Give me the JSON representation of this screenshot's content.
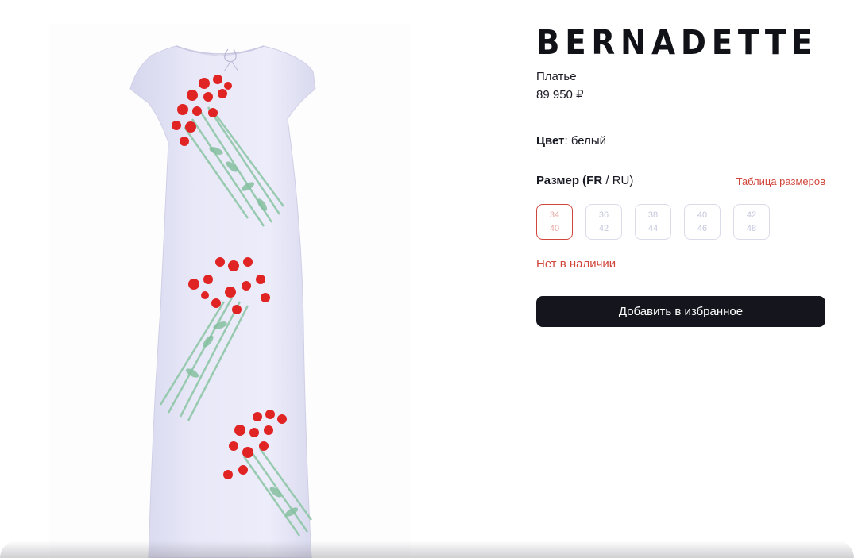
{
  "product": {
    "brand": "BERNADETTE",
    "type": "Платье",
    "price": "89 950 ₽",
    "image_alt_icon": "dress-with-red-roses-print"
  },
  "color": {
    "label": "Цвет",
    "value": ": белый"
  },
  "size": {
    "label_bold": "Размер (FR",
    "label_rest": " / RU)",
    "chart_link": "Таблица размеров",
    "options": [
      {
        "fr": "34",
        "ru": "40",
        "selected": true
      },
      {
        "fr": "36",
        "ru": "42",
        "selected": false
      },
      {
        "fr": "38",
        "ru": "44",
        "selected": false
      },
      {
        "fr": "40",
        "ru": "46",
        "selected": false
      },
      {
        "fr": "42",
        "ru": "48",
        "selected": false
      }
    ]
  },
  "stock_status": "Нет в наличии",
  "actions": {
    "favorite_label": "Добавить в избранное"
  },
  "colors": {
    "accent_red": "#d0463b",
    "button_dark": "#15161d",
    "dress": "#e3e3f5",
    "rose": "#e02424",
    "stem": "#8fc7a8"
  }
}
